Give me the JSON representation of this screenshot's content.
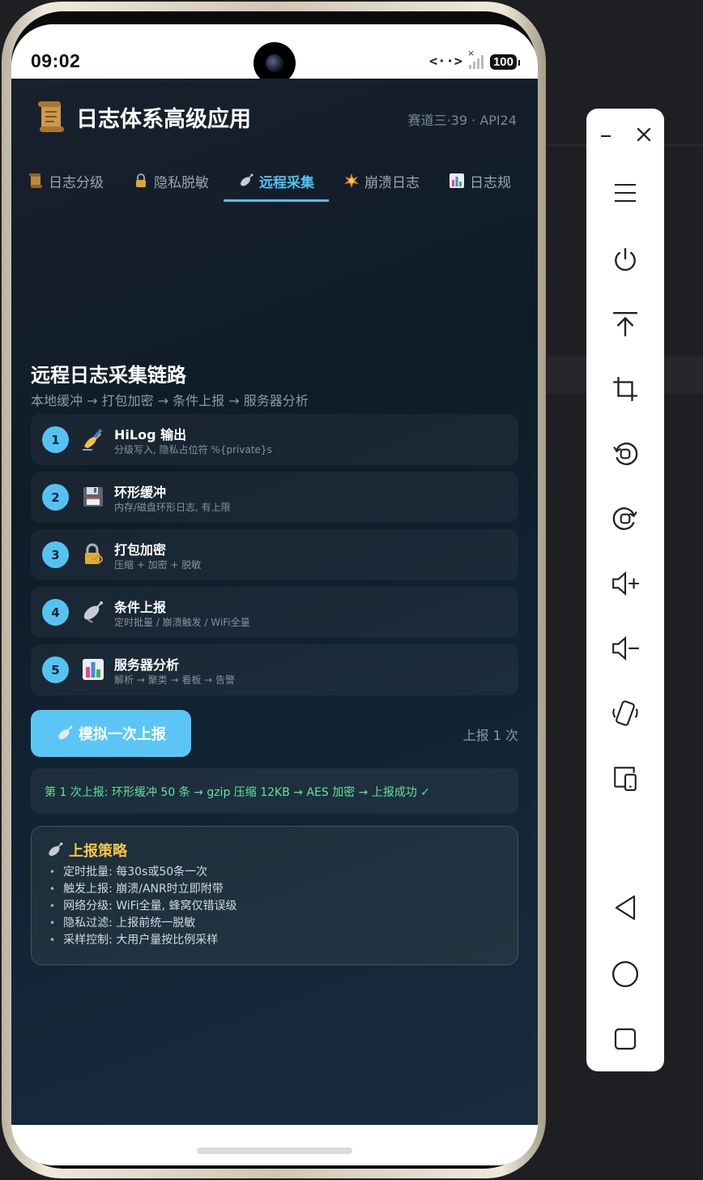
{
  "status_bar": {
    "time": "09:02",
    "net_symbol": "<··>",
    "battery": "100"
  },
  "header": {
    "title": "日志体系高级应用",
    "meta": "赛道三·39 · API24"
  },
  "tabs": [
    {
      "label": "日志分级",
      "icon": "scroll-icon",
      "active": false
    },
    {
      "label": "隐私脱敏",
      "icon": "lock-icon",
      "active": false
    },
    {
      "label": "远程采集",
      "icon": "satellite-icon",
      "active": true
    },
    {
      "label": "崩溃日志",
      "icon": "explosion-icon",
      "active": false
    },
    {
      "label": "日志规",
      "icon": "chart-icon",
      "active": false
    }
  ],
  "section": {
    "title": "远程日志采集链路",
    "subtitle": "本地缓冲 → 打包加密 → 条件上报 → 服务器分析"
  },
  "steps": [
    {
      "num": "1",
      "icon": "writing-hand-icon",
      "title": "HiLog 输出",
      "desc": "分级写入, 隐私占位符 %{private}s"
    },
    {
      "num": "2",
      "icon": "floppy-disk-icon",
      "title": "环形缓冲",
      "desc": "内存/磁盘环形日志, 有上限"
    },
    {
      "num": "3",
      "icon": "locked-key-icon",
      "title": "打包加密",
      "desc": "压缩 + 加密 + 脱敏"
    },
    {
      "num": "4",
      "icon": "satellite-dish-icon",
      "title": "条件上报",
      "desc": "定时批量 / 崩溃触发 / WiFi全量"
    },
    {
      "num": "5",
      "icon": "bar-chart-icon",
      "title": "服务器分析",
      "desc": "解析 → 聚类 → 看板 → 告警"
    }
  ],
  "simulate": {
    "button_label": "模拟一次上报",
    "count_label": "上报 1 次"
  },
  "result": {
    "text": "第 1 次上报: 环形缓冲 50 条 → gzip 压缩 12KB → AES 加密 → 上报成功 ✓"
  },
  "policy": {
    "title": "上报策略",
    "items": [
      "定时批量: 每30s或50条一次",
      "触发上报: 崩溃/ANR时立即附带",
      "网络分级: WiFi全量, 蜂窝仅错误级",
      "隐私过滤: 上报前统一脱敏",
      "采样控制: 大用户量按比例采样"
    ]
  },
  "colors": {
    "accent": "#4ec3f5",
    "success": "#5fe39b",
    "policy_title": "#f5c542"
  }
}
